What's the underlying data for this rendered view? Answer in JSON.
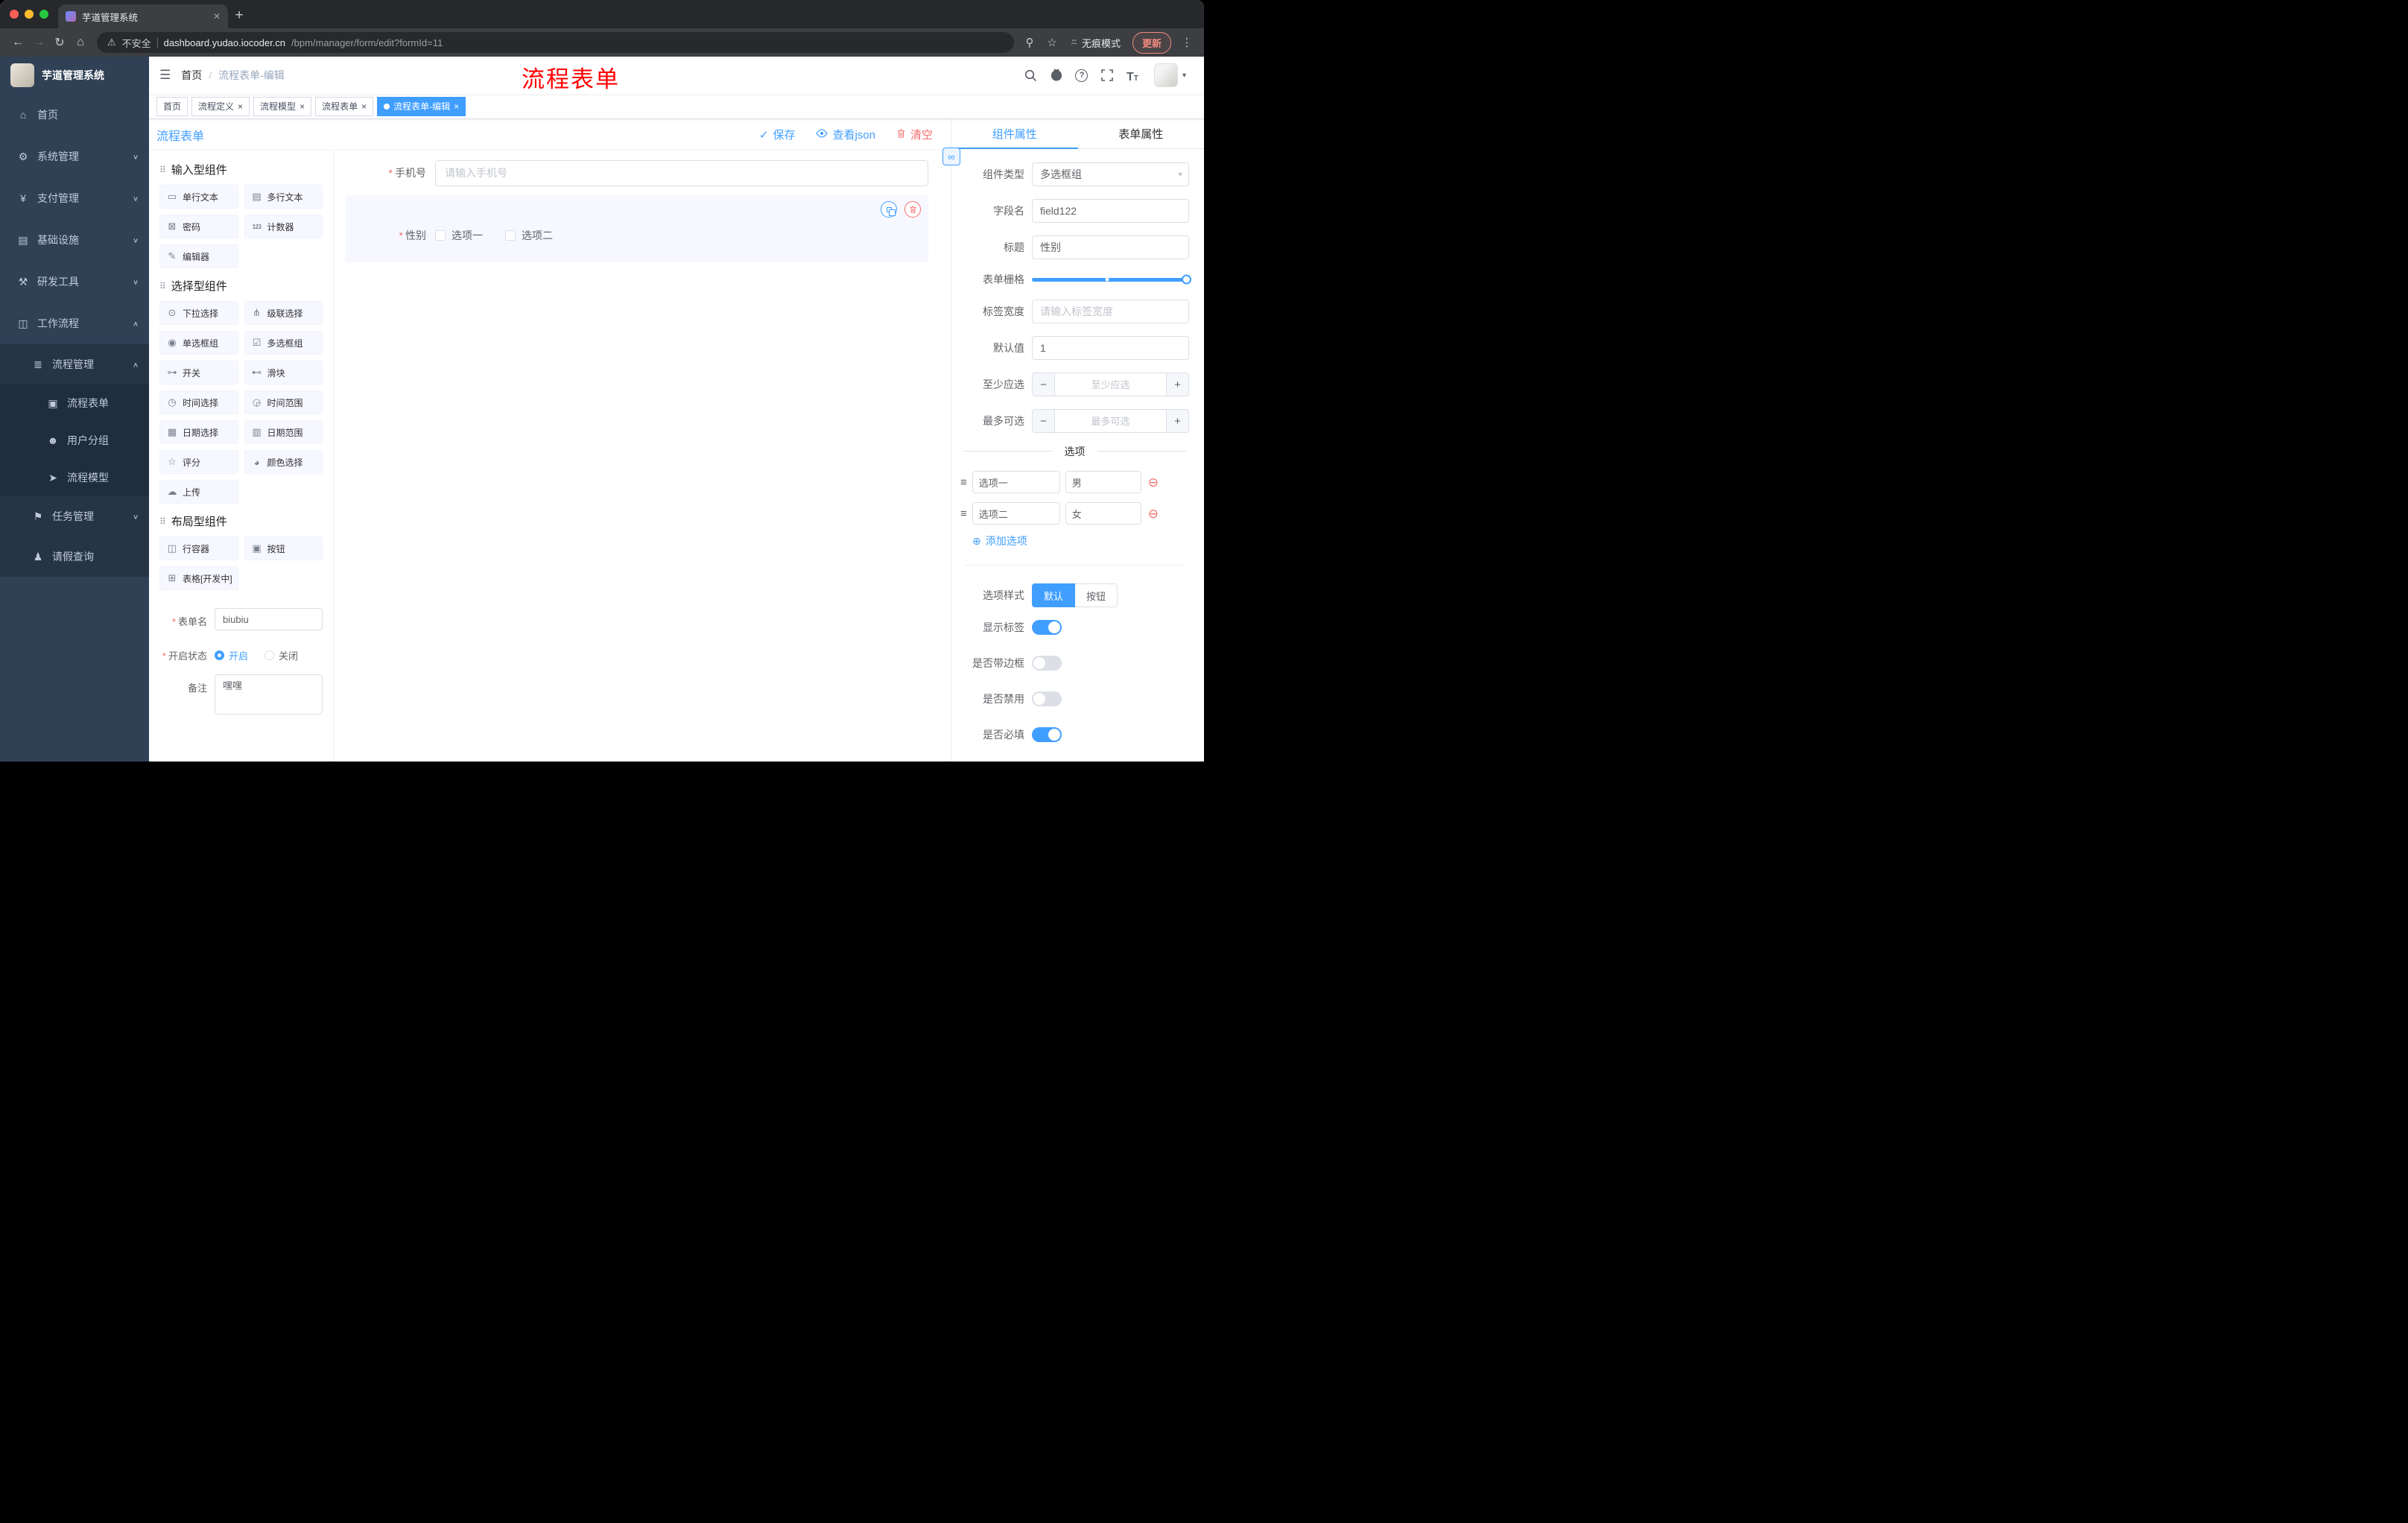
{
  "colors": {
    "accent": "#409EFF",
    "danger": "#F56C6C",
    "watermark": "#FF0000",
    "sidebar_bg": "#304156",
    "active_tab_bg": "#409EFF"
  },
  "common": {
    "required_mark": "*"
  },
  "browser": {
    "tab_title": "芋道管理系统",
    "tab_close": "✕",
    "new_tab_icon": "+",
    "nav": {
      "back": "←",
      "forward": "→",
      "reload": "↻",
      "home": "⌂"
    },
    "security_icon": "⚠",
    "security_label": "不安全",
    "url_domain": "dashboard.yudao.iocoder.cn",
    "url_path": "/bpm/manager/form/edit?formId=11",
    "key_icon": "⚲",
    "star_icon": "☆",
    "incognito_icon": "⍨",
    "incognito_label": "无痕模式",
    "update_label": "更新",
    "menu_icon": "⋮"
  },
  "sidebar": {
    "title": "芋道管理系统",
    "menu": [
      {
        "icon": "⌂",
        "label": "首页",
        "chevron": ""
      },
      {
        "icon": "⚙",
        "label": "系统管理",
        "chevron": "∨"
      },
      {
        "icon": "¥",
        "label": "支付管理",
        "chevron": "∨"
      },
      {
        "icon": "▤",
        "label": "基础设施",
        "chevron": "∨"
      },
      {
        "icon": "⚒",
        "label": "研发工具",
        "chevron": "∨"
      },
      {
        "icon": "◫",
        "label": "工作流程",
        "chevron": "∧"
      },
      {
        "icon": "≣",
        "label": "流程管理",
        "chevron": "∧"
      },
      {
        "icon": "▣",
        "label": "流程表单",
        "chevron": ""
      },
      {
        "icon": "☻",
        "label": "用户分组",
        "chevron": ""
      },
      {
        "icon": "➤",
        "label": "流程模型",
        "chevron": ""
      },
      {
        "icon": "⚑",
        "label": "任务管理",
        "chevron": "∨"
      },
      {
        "icon": "♟",
        "label": "请假查询",
        "chevron": ""
      }
    ]
  },
  "header": {
    "hamburger_icon": "☰",
    "breadcrumb_home": "首页",
    "breadcrumb_sep": "/",
    "breadcrumb_current": "流程表单-编辑",
    "watermark": "流程表单",
    "help_glyph": "?",
    "font_icon": "T",
    "caret_icon": "▾"
  },
  "tags_view": {
    "close_icon": "×",
    "tabs": [
      {
        "label": "首页"
      },
      {
        "label": "流程定义"
      },
      {
        "label": "流程模型"
      },
      {
        "label": "流程表单"
      },
      {
        "label": "流程表单-编辑"
      }
    ]
  },
  "designer": {
    "title": "流程表单",
    "save_icon": "✓",
    "save_label": "保存",
    "view_json_label": "查看json",
    "clear_label": "清空"
  },
  "palette": {
    "sections": [
      {
        "icon": "⠿",
        "title": "输入型组件",
        "items": [
          {
            "icon": "▭",
            "label": "单行文本"
          },
          {
            "icon": "▤",
            "label": "多行文本"
          },
          {
            "icon": "⊠",
            "label": "密码"
          },
          {
            "icon": "123",
            "label": "计数器"
          },
          {
            "icon": "✎",
            "label": "编辑器"
          }
        ]
      },
      {
        "icon": "⠿",
        "title": "选择型组件",
        "items": [
          {
            "icon": "⊙",
            "label": "下拉选择"
          },
          {
            "icon": "⋔",
            "label": "级联选择"
          },
          {
            "icon": "◉",
            "label": "单选框组"
          },
          {
            "icon": "☑",
            "label": "多选框组"
          },
          {
            "icon": "⊶",
            "label": "开关"
          },
          {
            "icon": "⊷",
            "label": "滑块"
          },
          {
            "icon": "◷",
            "label": "时间选择"
          },
          {
            "icon": "◶",
            "label": "时间范围"
          },
          {
            "icon": "▦",
            "label": "日期选择"
          },
          {
            "icon": "▥",
            "label": "日期范围"
          },
          {
            "icon": "☆",
            "label": "评分"
          },
          {
            "icon": "◕",
            "label": "颜色选择"
          },
          {
            "icon": "☁",
            "label": "上传"
          }
        ]
      },
      {
        "icon": "⠿",
        "title": "布局型组件",
        "items": [
          {
            "icon": "◫",
            "label": "行容器"
          },
          {
            "icon": "▣",
            "label": "按钮"
          },
          {
            "icon": "⊞",
            "label": "表格[开发中]"
          }
        ]
      }
    ],
    "form": {
      "name_label": "表单名",
      "name_value": "biubiu",
      "status_label": "开启状态",
      "status_on": "开启",
      "status_off": "关闭",
      "remark_label": "备注",
      "remark_value": "嘿嘿"
    }
  },
  "canvas": {
    "phone": {
      "label": "手机号",
      "placeholder": "请输入手机号"
    },
    "gender": {
      "label": "性别",
      "option1": "选项一",
      "option2": "选项二"
    }
  },
  "props": {
    "link_icon": "∞",
    "tab_component": "组件属性",
    "tab_form": "表单属性",
    "caret_icon": "▾",
    "component_type_label": "组件类型",
    "component_type_value": "多选框组",
    "field_name_label": "字段名",
    "field_name_value": "field122",
    "title_label": "标题",
    "title_value": "性别",
    "grid_label": "表单栅格",
    "label_width_label": "标签宽度",
    "label_width_placeholder": "请输入标签宽度",
    "default_label": "默认值",
    "default_value": "1",
    "minus": "−",
    "plus": "+",
    "min_label": "至少应选",
    "min_placeholder": "至少应选",
    "max_label": "最多可选",
    "max_placeholder": "最多可选",
    "options_divider": "选项",
    "drag_icon": "≡",
    "remove_icon": "⊖",
    "options": [
      {
        "name": "选项一",
        "value": "男"
      },
      {
        "name": "选项二",
        "value": "女"
      }
    ],
    "add_option_icon": "⊕",
    "add_option_label": "添加选项",
    "option_style_label": "选项样式",
    "option_style_default": "默认",
    "option_style_button": "按钮",
    "show_label_label": "显示标签",
    "border_label": "是否带边框",
    "disabled_label": "是否禁用",
    "required_label": "是否必填",
    "toggles": {
      "show_label": "on",
      "border": "off",
      "disabled": "off",
      "required": "on"
    }
  }
}
